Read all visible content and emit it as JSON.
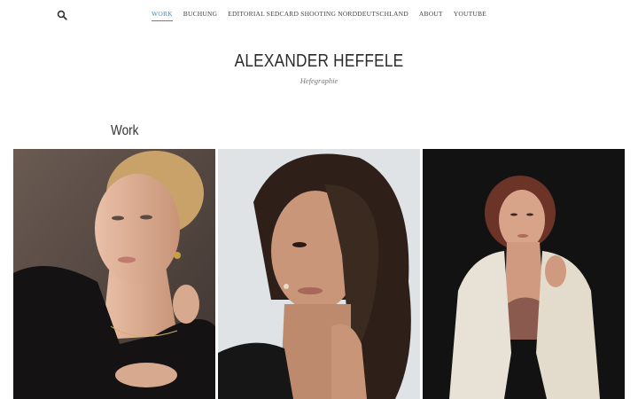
{
  "nav": {
    "items": [
      {
        "label": "WORK",
        "active": true
      },
      {
        "label": "BUCHUNG",
        "active": false
      },
      {
        "label": "EDITORIAL SEDCARD SHOOTING NORDDEUTSCHLAND",
        "active": false
      },
      {
        "label": "ABOUT",
        "active": false
      },
      {
        "label": "YOUTUBE",
        "active": false
      }
    ],
    "search_icon": "search-icon",
    "accent_color": "#3a8fc7"
  },
  "header": {
    "title": "ALEXANDER HEFFELE",
    "tagline": "Hefegraphie"
  },
  "section": {
    "heading": "Work"
  },
  "gallery": {
    "photos": [
      {
        "subject": "blonde-woman-black-top-gold-jewelry",
        "background": "#5b4e47"
      },
      {
        "subject": "dark-haired-woman-hand-at-neck",
        "background": "#dfe3e6"
      },
      {
        "subject": "red-haired-woman-white-blazer",
        "background": "#121212"
      }
    ]
  }
}
